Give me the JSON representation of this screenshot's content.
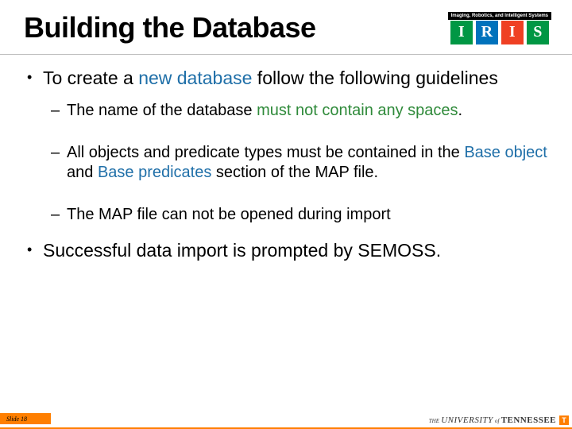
{
  "title": "Building the Database",
  "logo": {
    "caption": "Imaging, Robotics, and Intelligent Systems",
    "letters": [
      "I",
      "R",
      "I",
      "S"
    ]
  },
  "bullets": {
    "b1": {
      "pre": "To create a ",
      "hl": "new database",
      "post": " follow the following guidelines"
    },
    "b1s1": {
      "pre": "The name of the database ",
      "hl": "must not contain any spaces",
      "post": "."
    },
    "b1s2": {
      "t0": "All objects and predicate types must be contained in the ",
      "h1": "Base object",
      "t1": " and ",
      "h2": "Base predicates",
      "t2": " section of the MAP file."
    },
    "b1s3": "The MAP file can not be opened during import",
    "b2": "Successful data import is prompted by SEMOSS."
  },
  "footer": {
    "slide_label": "Slide 18",
    "university_the": "THE",
    "university_uni": "UNIVERSITY",
    "university_of": "of",
    "university_ten": "TENNESSEE",
    "ut_icon": "T"
  }
}
